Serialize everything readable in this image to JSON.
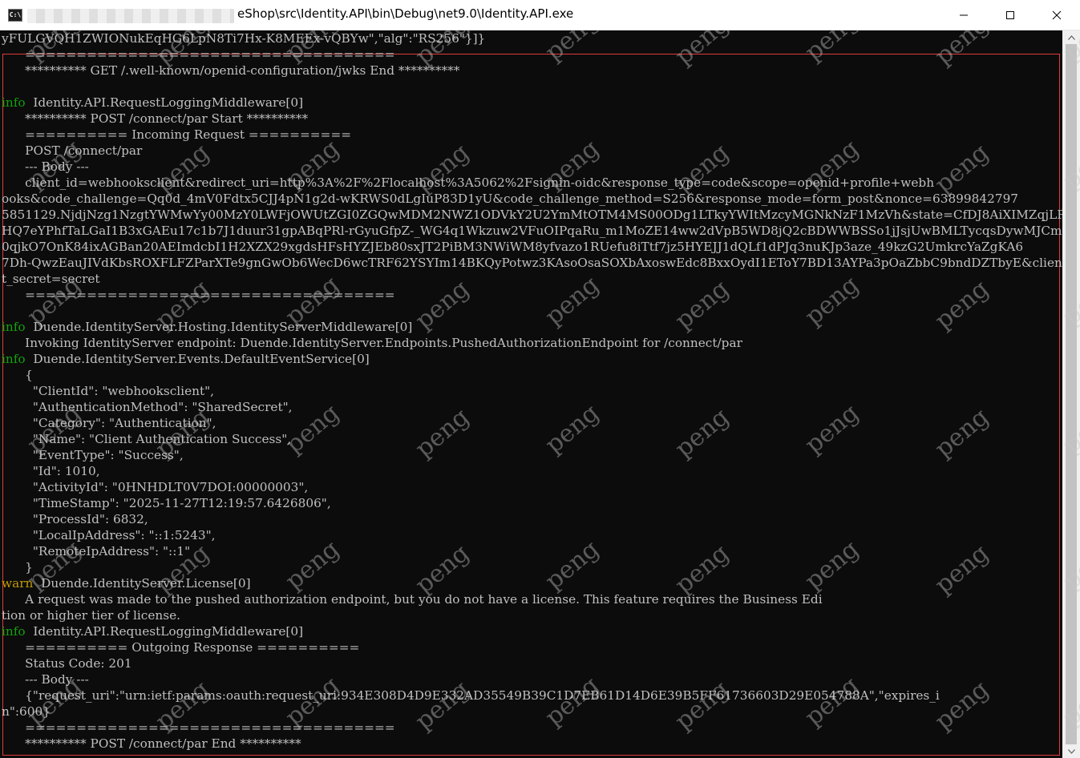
{
  "window": {
    "icon_text": "C:\\",
    "title": "eShop\\src\\Identity.API\\bin\\Debug\\net9.0\\Identity.API.exe",
    "controls": [
      "minimize",
      "maximize",
      "close"
    ]
  },
  "console": {
    "lines": [
      {
        "text": "yFULGVQH1ZWIONukEqHG6LpN8Ti7Hx-K8MEEx-vQBYw\",\"alg\":\"RS256\"}]}"
      },
      {
        "text": "      ===================================="
      },
      {
        "text": "      ********** GET /.well-known/openid-configuration/jwks End **********"
      },
      {
        "text": ""
      },
      {
        "level": "info",
        "text": "      Identity.API.RequestLoggingMiddleware[0]"
      },
      {
        "text": "      ********** POST /connect/par Start **********"
      },
      {
        "text": "      ========== Incoming Request =========="
      },
      {
        "text": "      POST /connect/par"
      },
      {
        "text": "      --- Body ---"
      },
      {
        "text": "      client_id=webhooksclient&redirect_uri=http%3A%2F%2Flocalhost%3A5062%2Fsignin-oidc&response_type=code&scope=openid+profile+webh"
      },
      {
        "text": "ooks&code_challenge=Qq0d_4mV0Fdtx5CJJ4pN1g2d-wKRWS0dLgIuP83D1yU&code_challenge_method=S256&response_mode=form_post&nonce=63899842797"
      },
      {
        "text": "5851129.NjdjNzg1NzgtYWMwYy00MzY0LWFjOWUtZGI0ZGQwMDM2NWZ1ODVkY2U2YmMtOTM4MS00ODg1LTkyYWItMzcyMGNkNzF1MzVh&state=CfDJ8AiXIMZqjLRDs2az9"
      },
      {
        "text": "HQ7eYPhfTaLGaI1B3xGAEu17c1b7J1duur31gpABqPRl-rGyuGfpZ-_WG4q1Wkzuw2VFuOIPqaRu_m1MoZE14ww2dVpB5WD8jQ2cBDWWBSSo1jJsjUwBMLTycqsDywMJCmoI"
      },
      {
        "text": "0qjkO7OnK84ixAGBan20AEImdcbI1H2XZX29xgdsHFsHYZJEb80sxJT2PiBM3NWiWM8yfvazo1RUefu8iTtf7jz5HYEJJ1dQLf1dPJq3nuKJp3aze_49kzG2UmkrcYaZgKA6"
      },
      {
        "text": "7Dh-QwzEauJIVdKbsROXFLFZParXTe9gnGwOb6WecD6wcTRF62YSYIm14BKQyPotwz3KAsoOsaSOXbAxoswEdc8BxxOydI1EToY7BD13AYPa3pOaZbbC9bndDZTbyE&clien"
      },
      {
        "text": "t_secret=secret"
      },
      {
        "text": "      ===================================="
      },
      {
        "text": ""
      },
      {
        "level": "info",
        "text": "      Duende.IdentityServer.Hosting.IdentityServerMiddleware[0]"
      },
      {
        "text": "      Invoking IdentityServer endpoint: Duende.IdentityServer.Endpoints.PushedAuthorizationEndpoint for /connect/par"
      },
      {
        "level": "info",
        "text": "      Duende.IdentityServer.Events.DefaultEventService[0]"
      },
      {
        "text": "      {"
      },
      {
        "text": "        \"ClientId\": \"webhooksclient\","
      },
      {
        "text": "        \"AuthenticationMethod\": \"SharedSecret\","
      },
      {
        "text": "        \"Category\": \"Authentication\","
      },
      {
        "text": "        \"Name\": \"Client Authentication Success\","
      },
      {
        "text": "        \"EventType\": \"Success\","
      },
      {
        "text": "        \"Id\": 1010,"
      },
      {
        "text": "        \"ActivityId\": \"0HNHDLT0V7DOI:00000003\","
      },
      {
        "text": "        \"TimeStamp\": \"2025-11-27T12:19:57.6426806\","
      },
      {
        "text": "        \"ProcessId\": 6832,"
      },
      {
        "text": "        \"LocalIpAddress\": \"::1:5243\","
      },
      {
        "text": "        \"RemoteIpAddress\": \"::1\""
      },
      {
        "text": "      }"
      },
      {
        "level": "warn",
        "text": "      Duende.IdentityServer.License[0]"
      },
      {
        "text": "      A request was made to the pushed authorization endpoint, but you do not have a license. This feature requires the Business Edi"
      },
      {
        "text": "tion or higher tier of license."
      },
      {
        "level": "info",
        "text": "      Identity.API.RequestLoggingMiddleware[0]"
      },
      {
        "text": "      ========== Outgoing Response =========="
      },
      {
        "text": "      Status Code: 201"
      },
      {
        "text": "      --- Body ---"
      },
      {
        "text": "      {\"request_uri\":\"urn:ietf:params:oauth:request_uri:934E308D4D9E332AD35549B39C1D7EB61D14D6E39B5FF61736603D29E054788A\",\"expires_i"
      },
      {
        "text": "n\":600}"
      },
      {
        "text": "      ===================================="
      },
      {
        "text": "      ********** POST /connect/par End **********"
      }
    ]
  },
  "watermark": {
    "text": "peng"
  },
  "colors": {
    "console_bg": "#0c0c0c",
    "console_text": "#c0c0c0",
    "info": "#13a10e",
    "warn": "#c19c00",
    "highlight_border": "#e03c3c"
  }
}
